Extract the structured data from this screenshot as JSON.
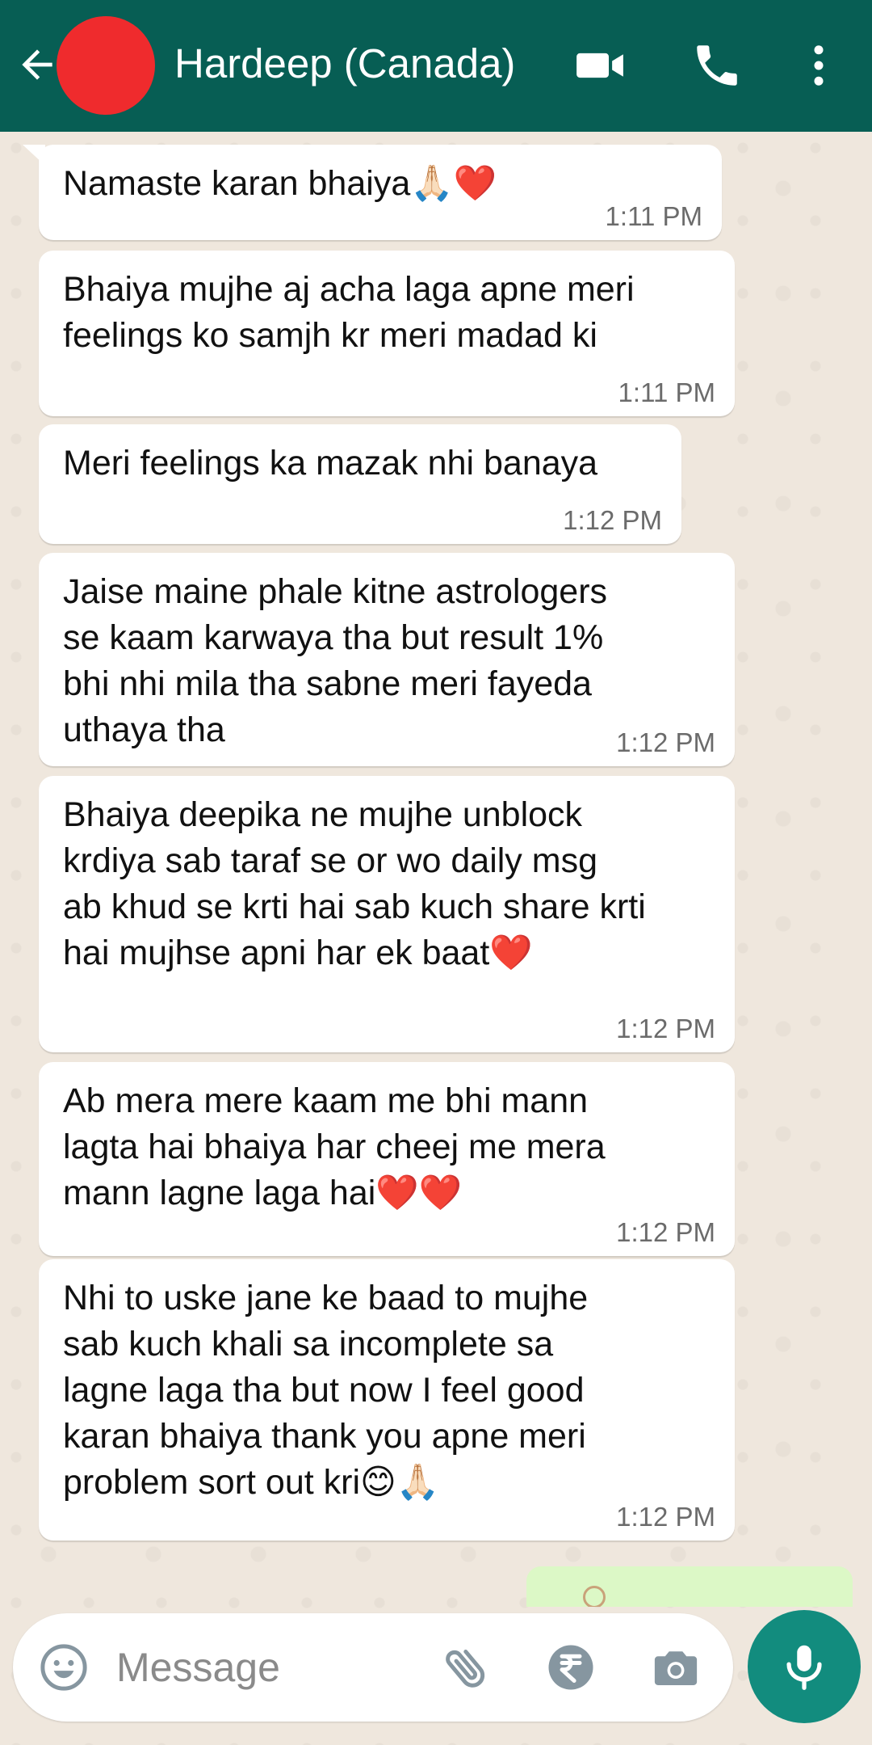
{
  "header": {
    "contact_name": "Hardeep (Canada)",
    "icons": [
      "back-arrow-icon",
      "video-call-icon",
      "voice-call-icon",
      "more-options-icon"
    ]
  },
  "messages": [
    {
      "text": "Namaste karan bhaiya",
      "emoji": "🙏🏻❤️",
      "time": "1:11 PM"
    },
    {
      "text": "Bhaiya mujhe aj acha laga apne meri\nfeelings ko samjh kr meri madad ki",
      "time": "1:11 PM"
    },
    {
      "text": "Meri feelings ka mazak nhi banaya",
      "time": "1:12 PM"
    },
    {
      "text": "Jaise maine phale kitne astrologers\nse kaam karwaya tha but result 1%\nbhi nhi mila tha sabne meri fayeda\nuthaya tha",
      "time": "1:12 PM"
    },
    {
      "text": "Bhaiya deepika ne mujhe unblock\nkrdiya sab taraf se or wo daily msg\nab khud se krti hai sab kuch share krti\nhai mujhse apni har ek baat",
      "emoji": "❤️",
      "time": "1:12 PM"
    },
    {
      "text": "Ab mera mere kaam me bhi mann\nlagta hai bhaiya har cheej me mera\nmann lagne laga hai",
      "emoji": "❤️❤️",
      "time": "1:12 PM"
    },
    {
      "text": "Nhi to uske jane ke baad to mujhe\nsab kuch khali sa incomplete sa\nlagne laga tha but now I feel good\nkaran bhaiya thank you apne meri\nproblem sort out kri",
      "emoji": "😊🙏🏻",
      "time": "1:12 PM"
    }
  ],
  "input": {
    "placeholder": "Message"
  },
  "colors": {
    "header": "#075e54",
    "mic_button": "#128c7e",
    "incoming_bubble": "#ffffff",
    "outgoing_bubble": "#dcf8c6",
    "wallpaper": "#efe7dd"
  }
}
